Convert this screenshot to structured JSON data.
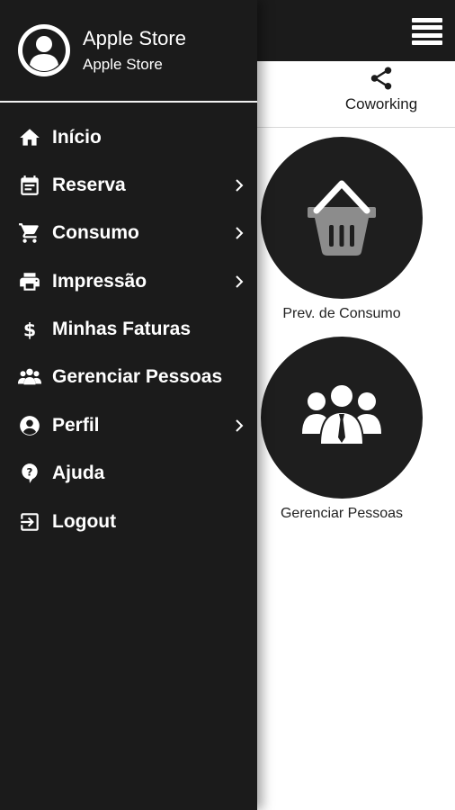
{
  "profile": {
    "name": "Apple Store",
    "subtitle": "Apple Store"
  },
  "menu": [
    {
      "label": "Início",
      "icon": "home-icon",
      "chevron": false
    },
    {
      "label": "Reserva",
      "icon": "calendar-icon",
      "chevron": true
    },
    {
      "label": "Consumo",
      "icon": "cart-icon",
      "chevron": true
    },
    {
      "label": "Impressão",
      "icon": "printer-icon",
      "chevron": true
    },
    {
      "label": "Minhas Faturas",
      "icon": "dollar-icon",
      "chevron": false
    },
    {
      "label": "Gerenciar Pessoas",
      "icon": "people-icon",
      "chevron": false
    },
    {
      "label": "Perfil",
      "icon": "account-circle-icon",
      "chevron": true
    },
    {
      "label": "Ajuda",
      "icon": "help-icon",
      "chevron": false
    },
    {
      "label": "Logout",
      "icon": "logout-icon",
      "chevron": false
    }
  ],
  "tabs": {
    "coworking": "Coworking"
  },
  "tiles": [
    {
      "label": "Prev. de Consumo",
      "icon": "basket-icon"
    },
    {
      "label": "Gerenciar Pessoas",
      "icon": "team-icon"
    }
  ],
  "colors": {
    "dark": "#1b1b1b",
    "text_light": "#ffffff",
    "divider": "#f2f2f2"
  }
}
